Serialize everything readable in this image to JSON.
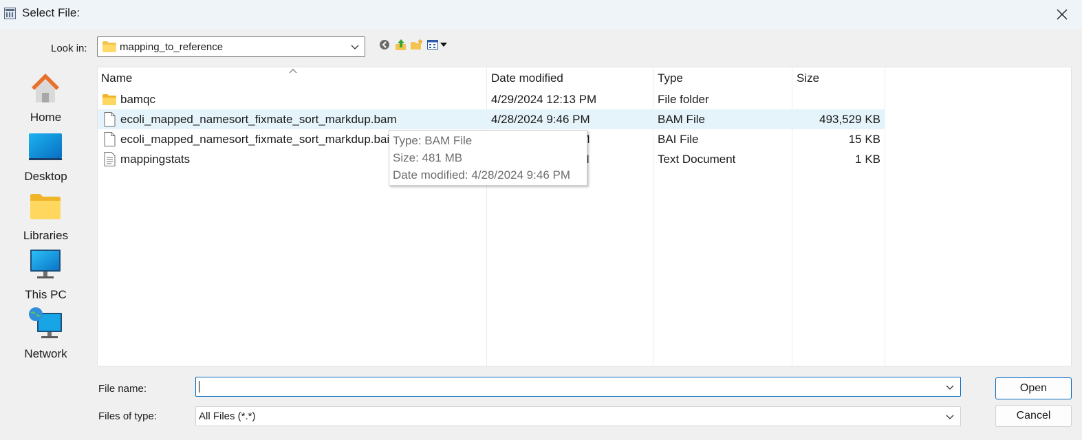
{
  "window": {
    "title": "Select File:"
  },
  "look_in": {
    "label": "Look in:",
    "value": "mapping_to_reference"
  },
  "toolbar": {
    "icons": [
      "back-icon",
      "up-folder-icon",
      "new-folder-icon",
      "view-menu-icon"
    ]
  },
  "places": [
    {
      "label": "Home",
      "icon": "home-icon"
    },
    {
      "label": "Desktop",
      "icon": "desktop-icon"
    },
    {
      "label": "Libraries",
      "icon": "libraries-icon"
    },
    {
      "label": "This PC",
      "icon": "this-pc-icon"
    },
    {
      "label": "Network",
      "icon": "network-icon"
    }
  ],
  "columns": {
    "name": "Name",
    "date": "Date modified",
    "type": "Type",
    "size": "Size"
  },
  "files": [
    {
      "name": "bamqc",
      "date": "4/29/2024 12:13 PM",
      "type": "File folder",
      "size": "",
      "icon": "folder-icon"
    },
    {
      "name": "ecoli_mapped_namesort_fixmate_sort_markdup.bam",
      "date": "4/28/2024 9:46 PM",
      "type": "BAM File",
      "size": "493,529 KB",
      "icon": "file-icon",
      "selected": true
    },
    {
      "name": "ecoli_mapped_namesort_fixmate_sort_markdup.bai",
      "date": "4/28/2024 9:46 PM",
      "type": "BAI File",
      "size": "15 KB",
      "icon": "file-icon"
    },
    {
      "name": "mappingstats",
      "date": "4/28/2024 9:46 AM",
      "type": "Text Document",
      "size": "1 KB",
      "icon": "text-file-icon"
    }
  ],
  "tooltip": {
    "type": "Type: BAM File",
    "size": "Size: 481 MB",
    "date": "Date modified: 4/28/2024 9:46 PM"
  },
  "file_name": {
    "label": "File name:",
    "value": ""
  },
  "file_type": {
    "label": "Files of type:",
    "value": "All Files (*.*)"
  },
  "buttons": {
    "open": "Open",
    "cancel": "Cancel"
  },
  "colors": {
    "selection": "#e5f3fb",
    "accent": "#0067c0",
    "titlebar": "#eff4f9"
  }
}
